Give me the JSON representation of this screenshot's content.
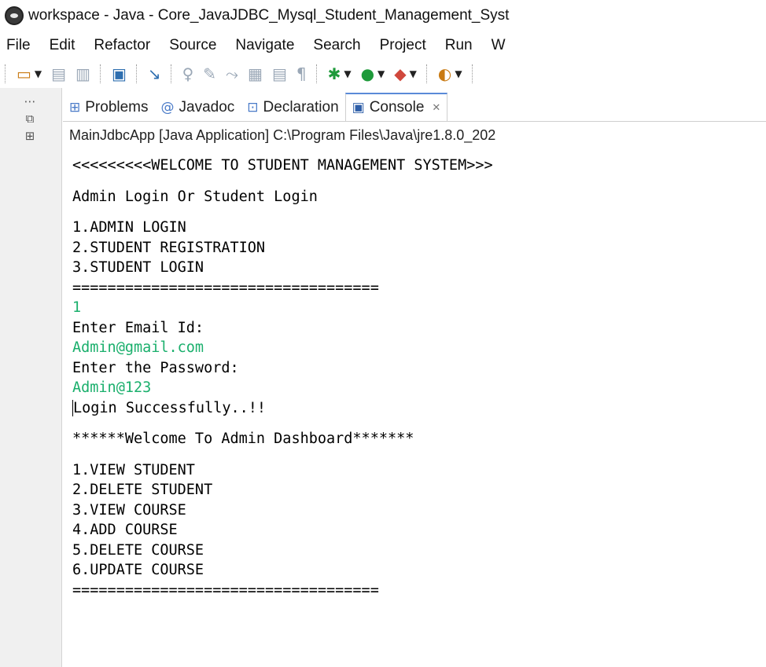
{
  "window": {
    "title": "workspace - Java - Core_JavaJDBC_Mysql_Student_Management_Syst"
  },
  "menu": [
    "File",
    "Edit",
    "Refactor",
    "Source",
    "Navigate",
    "Search",
    "Project",
    "Run",
    "W"
  ],
  "view_tabs": [
    {
      "label": "Problems",
      "icon": "problems-icon"
    },
    {
      "label": "Javadoc",
      "icon": "javadoc-icon"
    },
    {
      "label": "Declaration",
      "icon": "declaration-icon"
    },
    {
      "label": "Console",
      "icon": "console-icon",
      "active": true
    }
  ],
  "console": {
    "description": "MainJdbcApp [Java Application] C:\\Program Files\\Java\\jre1.8.0_202",
    "lines": [
      {
        "text": "<<<<<<<<<WELCOME TO STUDENT MANAGEMENT SYSTEM>>>",
        "kind": "output"
      },
      {
        "text": "",
        "kind": "blank"
      },
      {
        "text": "Admin Login Or Student Login",
        "kind": "output"
      },
      {
        "text": "",
        "kind": "blank"
      },
      {
        "text": "1.ADMIN LOGIN",
        "kind": "output"
      },
      {
        "text": "2.STUDENT REGISTRATION",
        "kind": "output"
      },
      {
        "text": "3.STUDENT LOGIN",
        "kind": "output"
      },
      {
        "text": "===================================",
        "kind": "output"
      },
      {
        "text": "1",
        "kind": "input"
      },
      {
        "text": "Enter Email Id:",
        "kind": "output"
      },
      {
        "text": "Admin@gmail.com",
        "kind": "input"
      },
      {
        "text": "Enter the Password:",
        "kind": "output"
      },
      {
        "text": "Admin@123",
        "kind": "input"
      },
      {
        "text": "Login Successfully..!!",
        "kind": "output",
        "cursor": true
      },
      {
        "text": "",
        "kind": "blank"
      },
      {
        "text": "******Welcome To Admin Dashboard*******",
        "kind": "output"
      },
      {
        "text": "",
        "kind": "blank"
      },
      {
        "text": "1.VIEW STUDENT",
        "kind": "output"
      },
      {
        "text": "2.DELETE STUDENT",
        "kind": "output"
      },
      {
        "text": "3.VIEW COURSE",
        "kind": "output"
      },
      {
        "text": "4.ADD COURSE",
        "kind": "output"
      },
      {
        "text": "5.DELETE COURSE",
        "kind": "output"
      },
      {
        "text": "6.UPDATE COURSE",
        "kind": "output"
      },
      {
        "text": "===================================",
        "kind": "output"
      }
    ]
  },
  "colors": {
    "input_text": "#1aaf6c",
    "active_tab_accent": "#5a8ad8"
  }
}
